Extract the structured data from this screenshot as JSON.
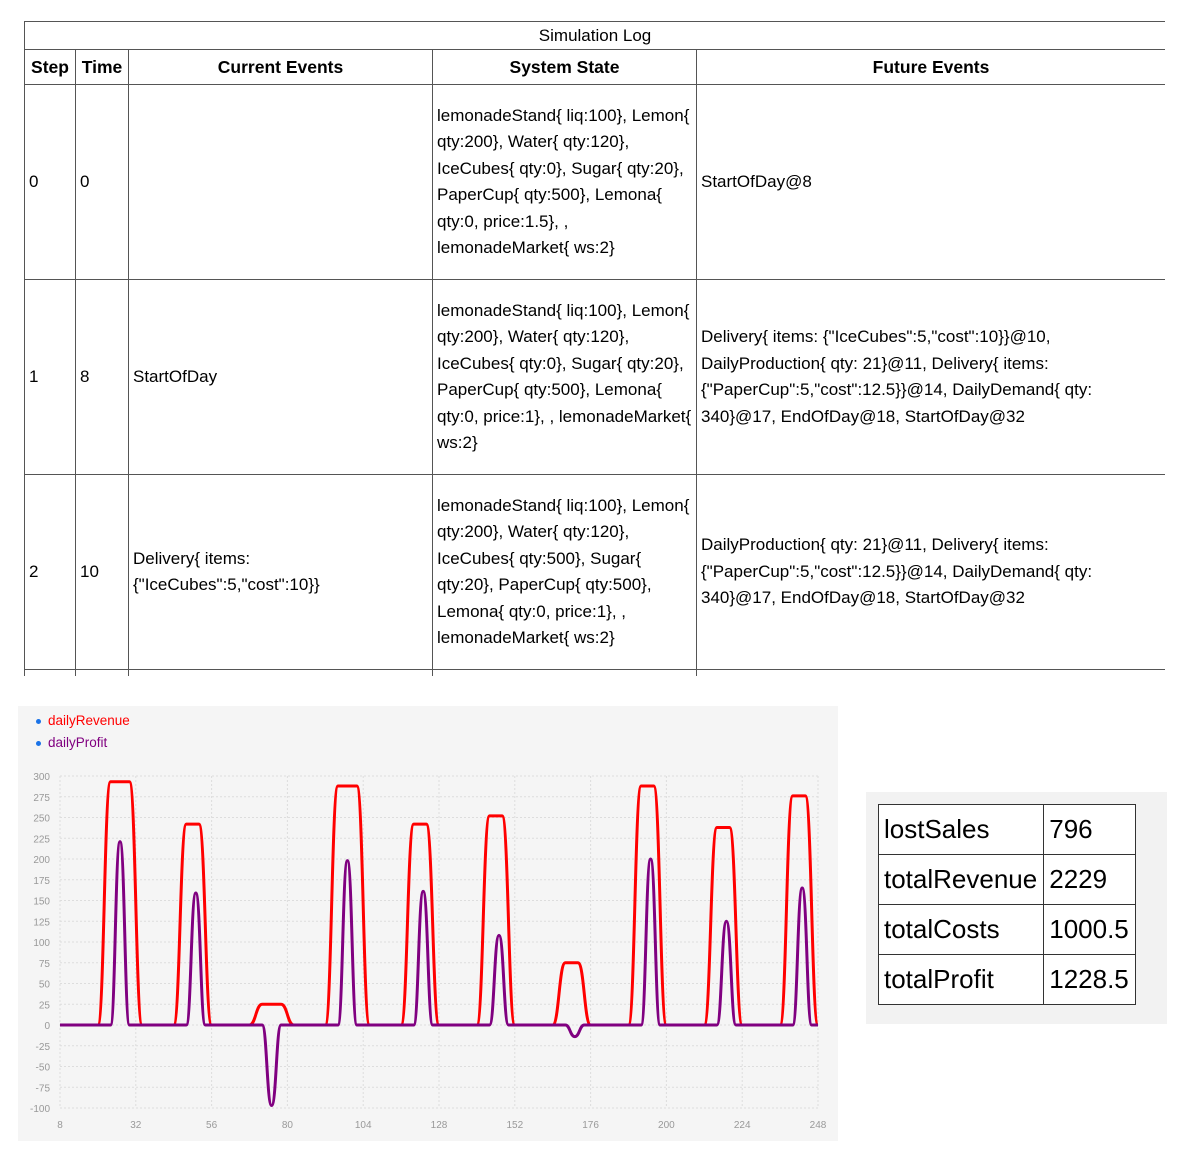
{
  "log": {
    "title": "Simulation Log",
    "columns": [
      "Step",
      "Time",
      "Current Events",
      "System State",
      "Future Events"
    ],
    "rows": [
      {
        "step": "0",
        "time": "0",
        "current": "",
        "state": "lemonadeStand{ liq:100}, Lemon{ qty:200}, Water{ qty:120}, IceCubes{ qty:0}, Sugar{ qty:20}, PaperCup{ qty:500}, Lemona{ qty:0, price:1.5}, , lemonadeMarket{ ws:2}",
        "future": "StartOfDay@8"
      },
      {
        "step": "1",
        "time": "8",
        "current": "StartOfDay",
        "state": "lemonadeStand{ liq:100}, Lemon{ qty:200}, Water{ qty:120}, IceCubes{ qty:0}, Sugar{ qty:20}, PaperCup{ qty:500}, Lemona{ qty:0, price:1}, , lemonadeMarket{ ws:2}",
        "future": "Delivery{ items: {\"IceCubes\":5,\"cost\":10}}@10, DailyProduction{ qty: 21}@11, Delivery{ items: {\"PaperCup\":5,\"cost\":12.5}}@14, DailyDemand{ qty: 340}@17, EndOfDay@18, StartOfDay@32"
      },
      {
        "step": "2",
        "time": "10",
        "current": "Delivery{ items: {\"IceCubes\":5,\"cost\":10}}",
        "state": "lemonadeStand{ liq:100}, Lemon{ qty:200}, Water{ qty:120}, IceCubes{ qty:500}, Sugar{ qty:20}, PaperCup{ qty:500}, Lemona{ qty:0, price:1}, , lemonadeMarket{ ws:2}",
        "future": "DailyProduction{ qty: 21}@11, Delivery{ items: {\"PaperCup\":5,\"cost\":12.5}}@14, DailyDemand{ qty: 340}@17, EndOfDay@18, StartOfDay@32"
      }
    ]
  },
  "chart_data": {
    "type": "line",
    "series": [
      {
        "name": "dailyRevenue",
        "color": "#ff0000",
        "points": [
          [
            8,
            0
          ],
          [
            12,
            0
          ],
          [
            20,
            0
          ],
          [
            24,
            293
          ],
          [
            30,
            293
          ],
          [
            34,
            0
          ],
          [
            44,
            0
          ],
          [
            48,
            242
          ],
          [
            52,
            242
          ],
          [
            56,
            0
          ],
          [
            68,
            0
          ],
          [
            72,
            25
          ],
          [
            78,
            25
          ],
          [
            82,
            0
          ],
          [
            92,
            0
          ],
          [
            96,
            288
          ],
          [
            102,
            288
          ],
          [
            106,
            0
          ],
          [
            116,
            0
          ],
          [
            120,
            242
          ],
          [
            124,
            242
          ],
          [
            128,
            0
          ],
          [
            140,
            0
          ],
          [
            144,
            252
          ],
          [
            148,
            252
          ],
          [
            152,
            0
          ],
          [
            164,
            0
          ],
          [
            168,
            75
          ],
          [
            172,
            75
          ],
          [
            176,
            0
          ],
          [
            188,
            0
          ],
          [
            192,
            288
          ],
          [
            196,
            288
          ],
          [
            200,
            0
          ],
          [
            212,
            0
          ],
          [
            216,
            238
          ],
          [
            220,
            238
          ],
          [
            224,
            0
          ],
          [
            236,
            0
          ],
          [
            240,
            276
          ],
          [
            244,
            276
          ],
          [
            248,
            0
          ]
        ]
      },
      {
        "name": "dailyProfit",
        "color": "#800080",
        "points": [
          [
            8,
            0
          ],
          [
            24,
            0
          ],
          [
            27,
            221
          ],
          [
            30,
            0
          ],
          [
            48,
            0
          ],
          [
            51,
            159
          ],
          [
            54,
            0
          ],
          [
            72,
            0
          ],
          [
            75,
            -97
          ],
          [
            78,
            0
          ],
          [
            96,
            0
          ],
          [
            99,
            198
          ],
          [
            102,
            0
          ],
          [
            120,
            0
          ],
          [
            123,
            161
          ],
          [
            126,
            0
          ],
          [
            144,
            0
          ],
          [
            147,
            108
          ],
          [
            150,
            0
          ],
          [
            168,
            0
          ],
          [
            171,
            -14
          ],
          [
            174,
            0
          ],
          [
            192,
            0
          ],
          [
            195,
            200
          ],
          [
            198,
            0
          ],
          [
            216,
            0
          ],
          [
            219,
            125
          ],
          [
            222,
            0
          ],
          [
            240,
            0
          ],
          [
            243,
            165
          ],
          [
            246,
            0
          ],
          [
            248,
            0
          ]
        ]
      }
    ],
    "xlim": [
      8,
      248
    ],
    "ylim": [
      -100,
      300
    ],
    "xticks": [
      8,
      32,
      56,
      80,
      104,
      128,
      152,
      176,
      200,
      224,
      248
    ],
    "yticks": [
      300,
      275,
      250,
      225,
      200,
      175,
      150,
      125,
      100,
      75,
      50,
      25,
      0,
      -25,
      -50,
      -75,
      -100
    ],
    "grid": true,
    "legend_position": "top-left"
  },
  "stats": {
    "rows": [
      {
        "label": "lostSales",
        "value": "796"
      },
      {
        "label": "totalRevenue",
        "value": "2229"
      },
      {
        "label": "totalCosts",
        "value": "1000.5"
      },
      {
        "label": "totalProfit",
        "value": "1228.5"
      }
    ]
  }
}
